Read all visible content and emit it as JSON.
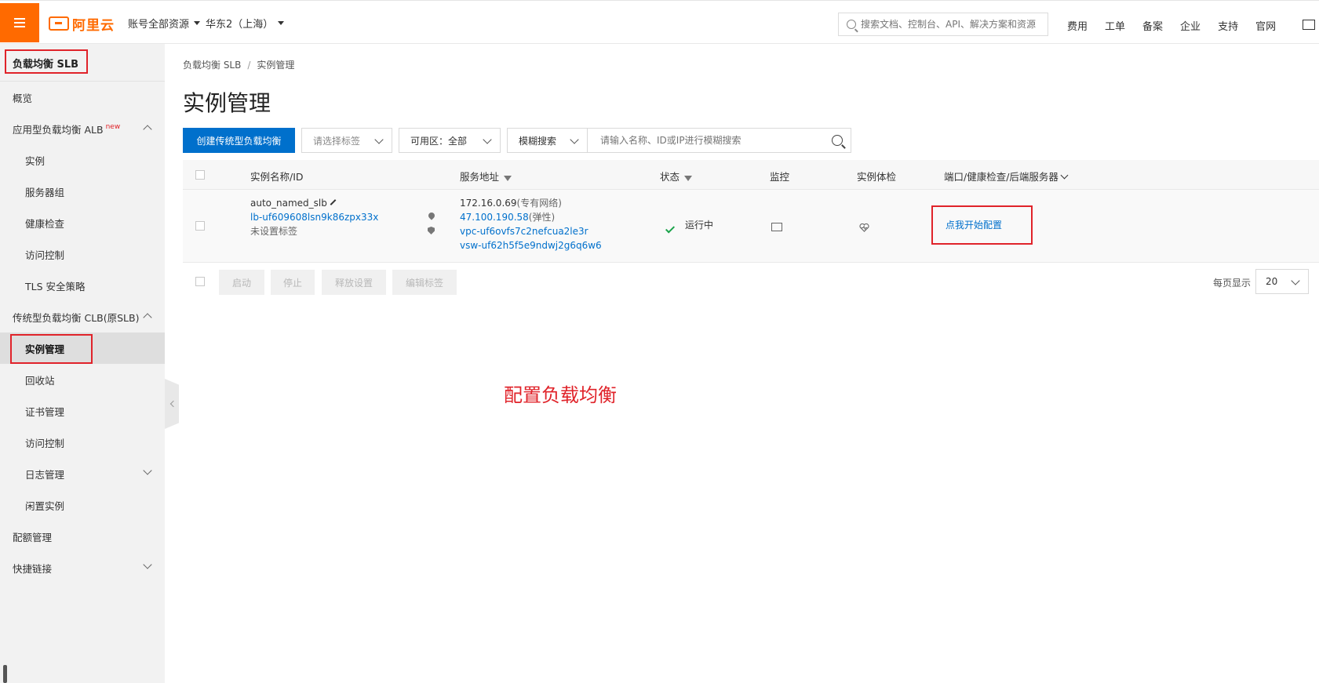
{
  "topbar": {
    "brand": "阿里云",
    "account_menu": "账号全部资源",
    "region_menu": "华东2（上海）",
    "search_placeholder": "搜索文档、控制台、API、解决方案和资源",
    "links": [
      "费用",
      "工单",
      "备案",
      "企业",
      "支持",
      "官网"
    ]
  },
  "sidebar": {
    "title": "负载均衡 SLB",
    "items": [
      {
        "label": "概览"
      },
      {
        "label": "应用型负载均衡 ALB",
        "badge": "new"
      },
      {
        "label": "实例"
      },
      {
        "label": "服务器组"
      },
      {
        "label": "健康检查"
      },
      {
        "label": "访问控制"
      },
      {
        "label": "TLS 安全策略"
      },
      {
        "label": "传统型负载均衡 CLB(原SLB)"
      },
      {
        "label": "实例管理"
      },
      {
        "label": "回收站"
      },
      {
        "label": "证书管理"
      },
      {
        "label": "访问控制"
      },
      {
        "label": "日志管理"
      },
      {
        "label": "闲置实例"
      },
      {
        "label": "配额管理"
      },
      {
        "label": "快捷链接"
      }
    ]
  },
  "breadcrumb": {
    "root": "负载均衡 SLB",
    "sep": "/",
    "current": "实例管理"
  },
  "page_title": "实例管理",
  "toolbar": {
    "create_button": "创建传统型负载均衡",
    "tag_select_placeholder": "请选择标签",
    "zone_select_label": "可用区：",
    "zone_select_value": "全部",
    "search_mode": "模糊搜索",
    "search_placeholder": "请输入名称、ID或IP进行模糊搜索"
  },
  "table": {
    "headers": {
      "name": "实例名称/ID",
      "address": "服务地址",
      "status": "状态",
      "monitor": "监控",
      "health": "实例体检",
      "ports": "端口/健康检查/后端服务器"
    },
    "rows": [
      {
        "name": "auto_named_slb",
        "id": "lb-uf609608lsn9k86zpx33x",
        "tags": "未设置标签",
        "private_ip": "172.16.0.69",
        "private_ip_note": "(专有网络)",
        "public_ip": "47.100.190.58",
        "public_ip_note": "(弹性)",
        "vpc": "vpc-uf6ovfs7c2nefcua2le3r",
        "vsw": "vsw-uf62h5f5e9ndwj2g6q6w6",
        "status": "运行中",
        "ports_action": "点我开始配置"
      }
    ]
  },
  "bulk_actions": [
    "启动",
    "停止",
    "释放设置",
    "编辑标签"
  ],
  "pager": {
    "label": "每页显示",
    "value": "20"
  },
  "annotation_text": "配置负载均衡",
  "colors": {
    "brand": "#ff6a00",
    "primary": "#0070cc",
    "highlight": "#e0232a",
    "success": "#1aa34a"
  }
}
